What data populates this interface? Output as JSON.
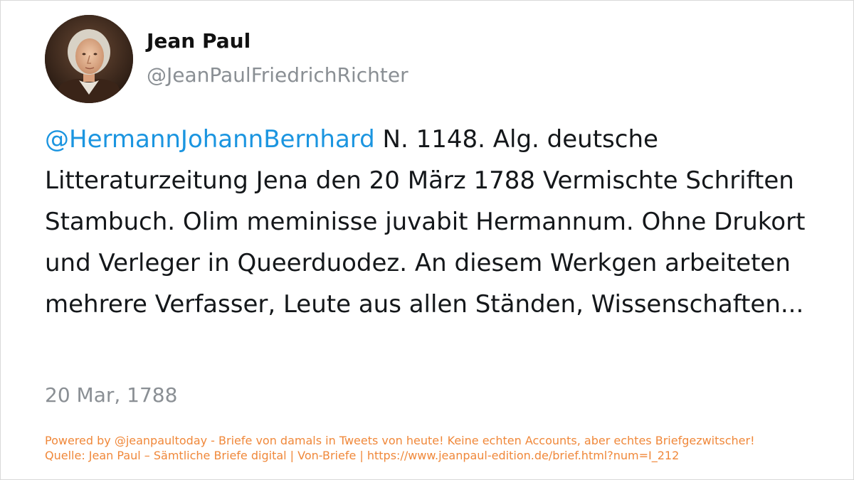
{
  "author": {
    "name": "Jean Paul",
    "handle": "@JeanPaulFriedrichRichter",
    "avatar_icon": "portrait-avatar"
  },
  "tweet": {
    "mention": "@HermannJohannBernhard",
    "text": " N. 1148. Alg. deutsche Litteraturzeitung Jena den 20 März 1788 Vermischte Schriften Stambuch. Olim meminisse juvabit Hermannum. Ohne Drukort und Verleger in Queerduodez. An diesem Werkgen arbeiteten mehrere Verfasser, Leute aus allen Ständen, Wissenschaften...",
    "date": "20 Mar, 1788"
  },
  "footer": {
    "line1": "Powered by @jeanpaultoday - Briefe von damals in Tweets von heute! Keine echten Accounts, aber echtes Briefgezwitscher!",
    "line2": "Quelle: Jean Paul – Sämtliche Briefe digital | Von-Briefe | https://www.jeanpaul-edition.de/brief.html?num=I_212"
  },
  "colors": {
    "mention": "#1b95e0",
    "footer": "#f0883a",
    "muted": "#8a8f94"
  }
}
